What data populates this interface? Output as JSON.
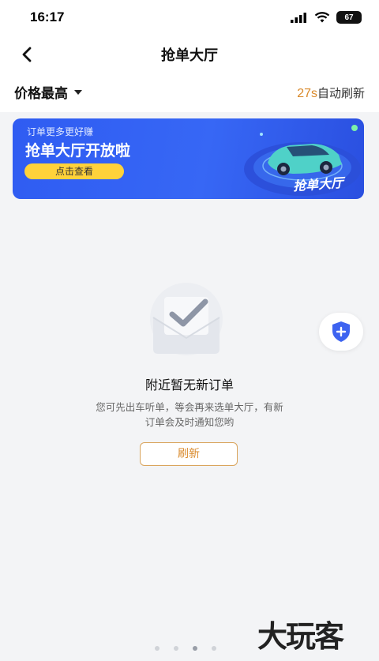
{
  "status_bar": {
    "time": "16:17",
    "battery": "67"
  },
  "nav": {
    "title": "抢单大厅"
  },
  "filter": {
    "sort_label": "价格最高",
    "countdown_seconds": "27s",
    "countdown_suffix": "自动刷新"
  },
  "banner": {
    "subtitle": "订单更多更好赚",
    "title": "抢单大厅开放啦",
    "button_label": "点击查看",
    "art_text": "抢单大厅"
  },
  "empty_state": {
    "title": "附近暂无新订单",
    "description_line1": "您可先出车听单，等会再来选单大厅，有新",
    "description_line2": "订单会及时通知您哟",
    "refresh_label": "刷新"
  },
  "pagination": {
    "total": 4,
    "active_index": 2
  },
  "watermark": {
    "text": "大玩客"
  },
  "colors": {
    "accent": "#d9892a",
    "banner_blue": "#3767f5",
    "banner_button": "#ffd23a"
  }
}
